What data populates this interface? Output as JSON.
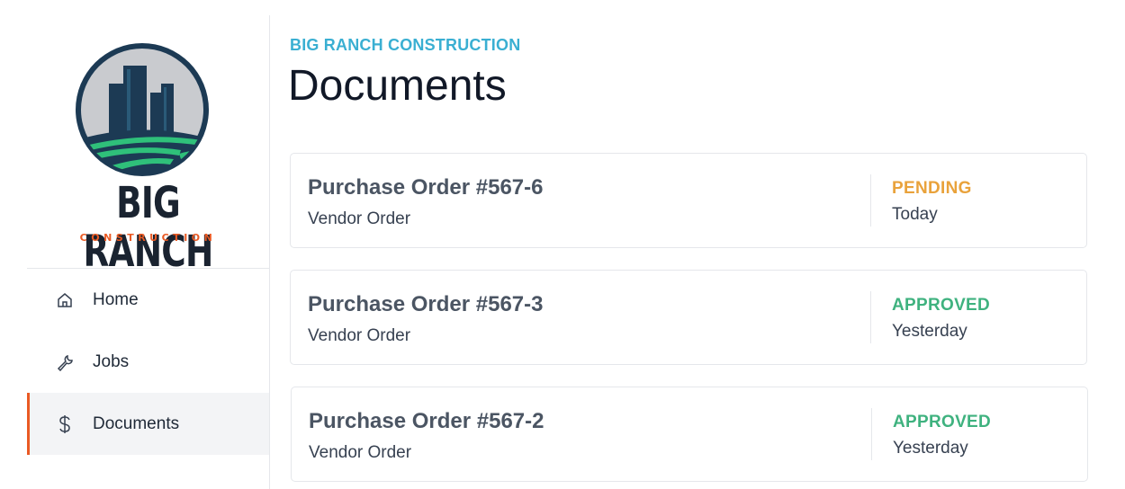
{
  "brand": {
    "logo_name": "BIG RANCH",
    "logo_subtitle": "CONSTRUCTION",
    "eyebrow": "BIG RANCH CONSTRUCTION",
    "colors": {
      "accent_orange": "#ea5a24",
      "eyebrow_blue": "#3aafd2",
      "logo_navy": "#1c3a54",
      "logo_green": "#2fc07a"
    }
  },
  "sidebar": {
    "items": [
      {
        "label": "Home",
        "icon": "home-icon",
        "active": false
      },
      {
        "label": "Jobs",
        "icon": "wrench-icon",
        "active": false
      },
      {
        "label": "Documents",
        "icon": "dollar-icon",
        "active": true
      }
    ]
  },
  "page": {
    "title": "Documents"
  },
  "documents": [
    {
      "title": "Purchase Order #567-6",
      "subtitle": "Vendor Order",
      "status": "PENDING",
      "status_color": "#e9a23b",
      "date": "Today"
    },
    {
      "title": "Purchase Order #567-3",
      "subtitle": "Vendor Order",
      "status": "APPROVED",
      "status_color": "#3fb27f",
      "date": "Yesterday"
    },
    {
      "title": "Purchase Order #567-2",
      "subtitle": "Vendor Order",
      "status": "APPROVED",
      "status_color": "#3fb27f",
      "date": "Yesterday"
    }
  ]
}
